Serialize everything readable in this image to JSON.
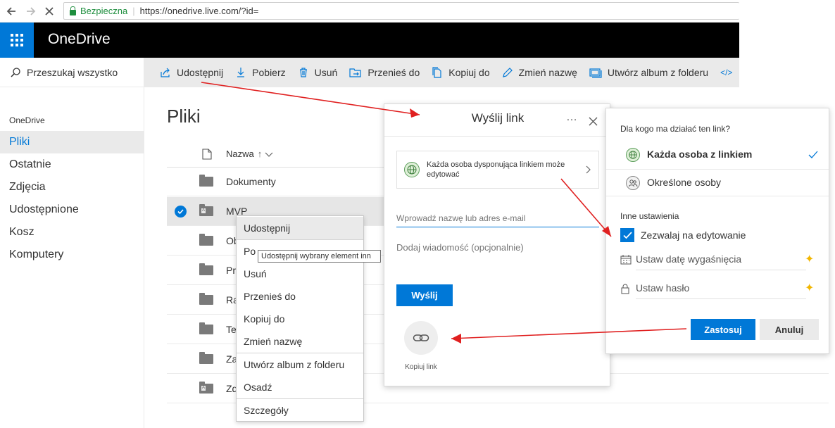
{
  "browser": {
    "secure_label": "Bezpieczna",
    "url": "https://onedrive.live.com/?id="
  },
  "header": {
    "app_name": "OneDrive"
  },
  "sidebar": {
    "search_placeholder": "Przeszukaj wszystko",
    "section_label": "OneDrive",
    "items": [
      {
        "label": "Pliki",
        "selected": true
      },
      {
        "label": "Ostatnie"
      },
      {
        "label": "Zdjęcia"
      },
      {
        "label": "Udostępnione"
      },
      {
        "label": "Kosz"
      },
      {
        "label": "Komputery"
      }
    ]
  },
  "toolbar": {
    "share": "Udostępnij",
    "download": "Pobierz",
    "delete": "Usuń",
    "move": "Przenieś do",
    "copy": "Kopiuj do",
    "rename": "Zmień nazwę",
    "create_album": "Utwórz album z folderu",
    "embed_icon": "</>"
  },
  "files": {
    "title": "Pliki",
    "column_name": "Nazwa",
    "rows": [
      {
        "name": "Dokumenty"
      },
      {
        "name": "MVP",
        "selected": true
      },
      {
        "name": "Ob"
      },
      {
        "name": "Pr"
      },
      {
        "name": "Ra"
      },
      {
        "name": "Te"
      },
      {
        "name": "Za"
      },
      {
        "name": "Zd"
      }
    ]
  },
  "context_menu": {
    "items": [
      "Udostępnij",
      "Pobierz",
      "Usuń",
      "Przenieś do",
      "Kopiuj do",
      "Zmień nazwę",
      "Utwórz album z folderu",
      "Osadź",
      "Szczegóły"
    ],
    "visible_partial_item": "Po",
    "tooltip": "Udostępnij wybrany element inn"
  },
  "send_link": {
    "title": "Wyślij link",
    "more_icon": "…",
    "link_description": "Każda osoba dysponująca linkiem może edytować",
    "email_placeholder": "Wprowadź nazwę lub adres e-mail",
    "message_placeholder": "Dodaj wiadomość (opcjonalnie)",
    "send_button": "Wyślij",
    "copy_link_label": "Kopiuj link"
  },
  "link_settings": {
    "question": "Dla kogo ma działać ten link?",
    "option_anyone": "Każda osoba z linkiem",
    "option_specific": "Określone osoby",
    "other_settings_title": "Inne ustawienia",
    "allow_editing": "Zezwalaj na edytowanie",
    "allow_editing_checked": true,
    "set_expiration": "Ustaw datę wygaśnięcia",
    "set_password": "Ustaw hasło",
    "apply_button": "Zastosuj",
    "cancel_button": "Anuluj"
  },
  "colors": {
    "accent": "#0078d7",
    "header_bg": "#000000",
    "annotation_arrow": "#e02020",
    "premium_star": "#f2b600"
  }
}
